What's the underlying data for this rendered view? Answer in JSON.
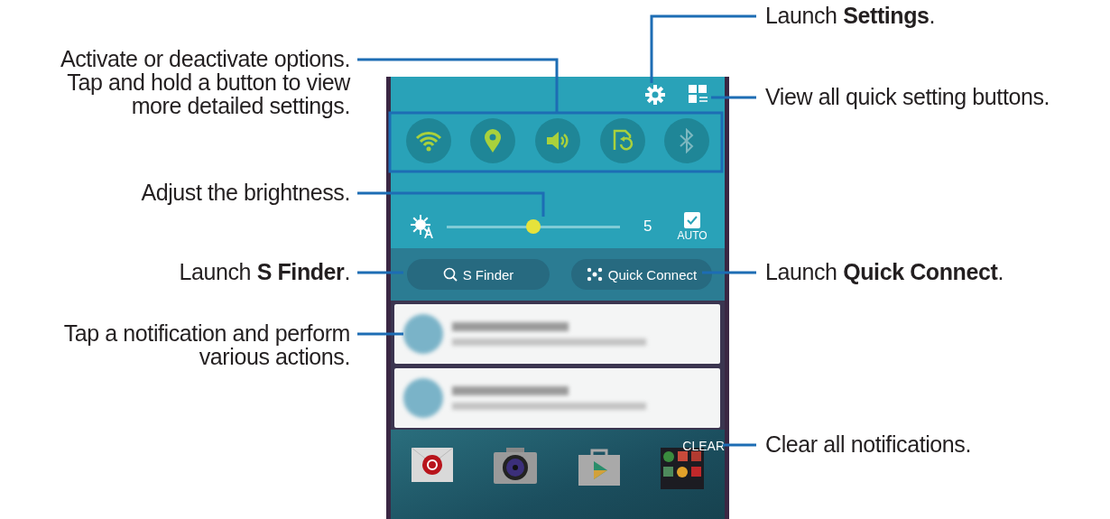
{
  "callouts": [
    {
      "text": "Activate or deactivate options.\nTap and hold a button to view\nmore detailed settings."
    },
    {
      "text": "Adjust the brightness."
    },
    {
      "text": "Launch **S Finder**."
    },
    {
      "text": "Tap a notification and perform\nvarious actions."
    },
    {
      "text": "Launch **Settings**."
    },
    {
      "text": "View all quick setting buttons."
    },
    {
      "text": "Launch **Quick Connect**."
    },
    {
      "text": "Clear all notifications."
    }
  ],
  "quick_settings": [
    {
      "kind": "wifi",
      "on": true
    },
    {
      "kind": "location",
      "on": true
    },
    {
      "kind": "sound",
      "on": true
    },
    {
      "kind": "rotation",
      "on": true
    },
    {
      "kind": "bluetooth",
      "on": false
    }
  ],
  "brightness": {
    "level": 0.5,
    "value": "5",
    "auto": {
      "label": "AUTO",
      "checked": true
    }
  },
  "buttons": [
    {
      "kind": "finder",
      "label": "S Finder"
    },
    {
      "kind": "connect",
      "label": "Quick Connect"
    }
  ],
  "notifications": [
    {
      "kind": "blurred"
    },
    {
      "kind": "blurred"
    }
  ],
  "clear_label": "CLEAR",
  "home_apps": [
    {
      "kind": "email"
    },
    {
      "kind": "camera"
    },
    {
      "kind": "store"
    },
    {
      "kind": "folder"
    }
  ]
}
